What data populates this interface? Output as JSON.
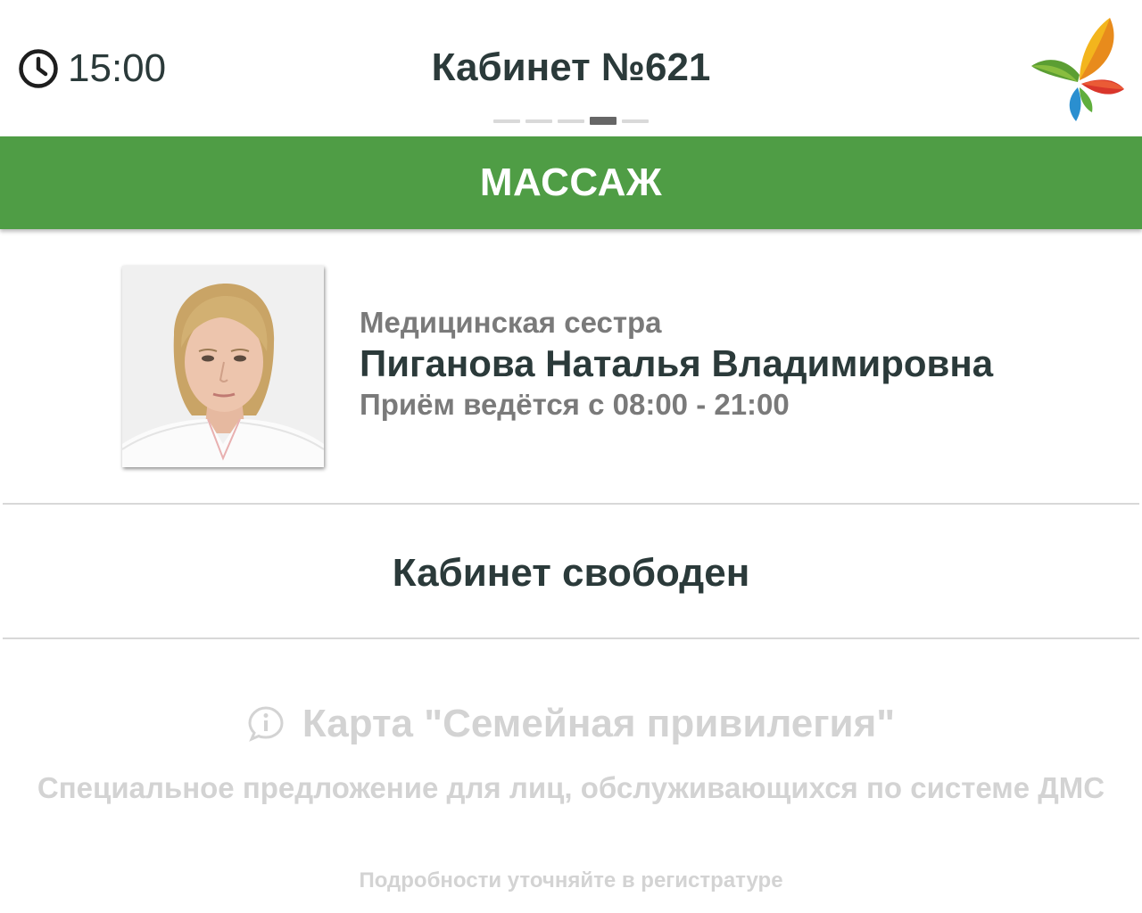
{
  "header": {
    "time": "15:00",
    "clock_icon": "clock-icon",
    "room_title": "Кабинет №621",
    "logo_icon": "butterfly-leaf-logo",
    "pager": {
      "count": 5,
      "active_index": 3
    }
  },
  "service": {
    "title": "МАССАЖ",
    "color": "#4f9d45"
  },
  "doctor": {
    "position": "Медицинская сестра",
    "name": "Пиганова Наталья Владимировна",
    "hours": "Приём ведётся с 08:00 - 21:00"
  },
  "status": {
    "text": "Кабинет свободен"
  },
  "promo": {
    "icon": "info-icon",
    "title": "Карта \"Семейная привилегия\"",
    "text": "Специальное предложение для лиц, обслуживающихся по системе ДМС",
    "note": "Подробности уточняйте в регистратуре"
  }
}
